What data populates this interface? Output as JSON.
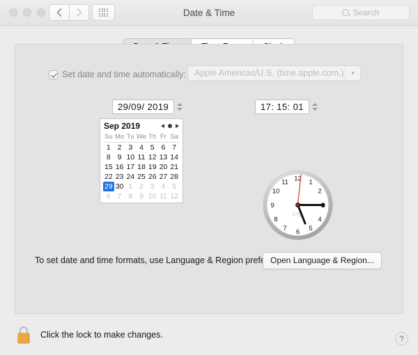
{
  "window": {
    "title": "Date & Time",
    "back_icon": "chevron-left-icon",
    "forward_icon": "chevron-right-icon",
    "show_all_icon": "grid-icon"
  },
  "search": {
    "placeholder": "Search",
    "icon": "search-icon",
    "value": ""
  },
  "tabs": [
    {
      "label": "Date & Time",
      "active": true
    },
    {
      "label": "Time Zone",
      "active": false
    },
    {
      "label": "Clock",
      "active": false
    }
  ],
  "auto": {
    "checkbox_label": "Set date and time automatically:",
    "checked": true,
    "server_value": "Apple Americas/U.S. (time.apple.com.)",
    "dropdown_icon": "chevron-down-icon"
  },
  "fields": {
    "date_value": "29/09/ 2019",
    "time_value": "17: 15: 01",
    "stepper_icon": "stepper-arrows-icon"
  },
  "calendar": {
    "title": "Sep 2019",
    "prev_icon": "triangle-left-icon",
    "today_icon": "dot-icon",
    "next_icon": "triangle-right-icon",
    "weekdays": [
      "Su",
      "Mo",
      "Tu",
      "We",
      "Th",
      "Fr",
      "Sa"
    ],
    "selected_day": 29,
    "weeks": [
      [
        {
          "d": "1",
          "other": false
        },
        {
          "d": "2",
          "other": false
        },
        {
          "d": "3",
          "other": false
        },
        {
          "d": "4",
          "other": false
        },
        {
          "d": "5",
          "other": false
        },
        {
          "d": "6",
          "other": false
        },
        {
          "d": "7",
          "other": false
        }
      ],
      [
        {
          "d": "8",
          "other": false
        },
        {
          "d": "9",
          "other": false
        },
        {
          "d": "10",
          "other": false
        },
        {
          "d": "11",
          "other": false
        },
        {
          "d": "12",
          "other": false
        },
        {
          "d": "13",
          "other": false
        },
        {
          "d": "14",
          "other": false
        }
      ],
      [
        {
          "d": "15",
          "other": false
        },
        {
          "d": "16",
          "other": false
        },
        {
          "d": "17",
          "other": false
        },
        {
          "d": "18",
          "other": false
        },
        {
          "d": "19",
          "other": false
        },
        {
          "d": "20",
          "other": false
        },
        {
          "d": "21",
          "other": false
        }
      ],
      [
        {
          "d": "22",
          "other": false
        },
        {
          "d": "23",
          "other": false
        },
        {
          "d": "24",
          "other": false
        },
        {
          "d": "25",
          "other": false
        },
        {
          "d": "26",
          "other": false
        },
        {
          "d": "27",
          "other": false
        },
        {
          "d": "28",
          "other": false
        }
      ],
      [
        {
          "d": "29",
          "other": false,
          "sel": true
        },
        {
          "d": "30",
          "other": false
        },
        {
          "d": "1",
          "other": true
        },
        {
          "d": "2",
          "other": true
        },
        {
          "d": "3",
          "other": true
        },
        {
          "d": "4",
          "other": true
        },
        {
          "d": "5",
          "other": true
        }
      ],
      [
        {
          "d": "6",
          "other": true
        },
        {
          "d": "7",
          "other": true
        },
        {
          "d": "8",
          "other": true
        },
        {
          "d": "9",
          "other": true
        },
        {
          "d": "10",
          "other": true
        },
        {
          "d": "11",
          "other": true
        },
        {
          "d": "12",
          "other": true
        }
      ]
    ]
  },
  "clock": {
    "meridiem": "PM",
    "hour_numbers": [
      "12",
      "1",
      "2",
      "3",
      "4",
      "5",
      "6",
      "7",
      "8",
      "9",
      "10",
      "11"
    ],
    "hour_hand_deg": 157,
    "minute_hand_deg": 90,
    "second_hand_deg": 6,
    "second_hand_color": "#e03030",
    "face_color": "#ffffff",
    "bezel_color": "#b4b8ba"
  },
  "footer": {
    "note": "To set date and time formats, use Language & Region preferences.",
    "button_label": "Open Language & Region..."
  },
  "bottom": {
    "lock_icon": "lock-closed-icon",
    "lock_text": "Click the lock to make changes.",
    "help_icon": "question-mark-icon",
    "help_label": "?"
  }
}
